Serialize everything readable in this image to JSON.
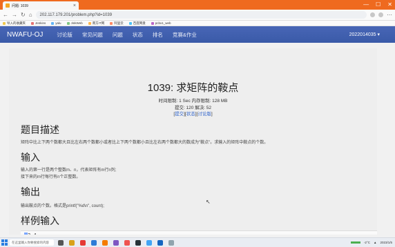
{
  "browser": {
    "tab_title": "问题: 1039",
    "url": "202.117.179.201/problem.php?id=1039",
    "win_minimize": "—",
    "win_maximize": "☐",
    "win_close": "✕",
    "bookmarks": [
      "导入的收藏夹",
      "Jenkins",
      "yalu",
      "JinkWeb",
      "南方IT网",
      "阿里云",
      "百度网盘",
      "pcbx1_web"
    ]
  },
  "site": {
    "brand": "NWAFU-OJ",
    "nav": [
      "讨论版",
      "常见问题",
      "问题",
      "状态",
      "排名",
      "竞赛&作业"
    ],
    "user": "2022014035 ▾"
  },
  "problem": {
    "title": "1039: 求矩阵的鞍点",
    "limits": "时间限制: 1 Sec  内存限制: 128 MB",
    "stats": "提交: 120  解决: 52",
    "links": [
      "提交",
      "状态",
      "讨论版"
    ]
  },
  "sections": {
    "desc_h": "题目描述",
    "desc_p": "矩阵中比上下两个数都大且比左右两个数都小或者比上下两个数都小且比左右两个数都大的数成为\"鞍点\"。求输入的矩阵中鞍点的个数。",
    "input_h": "输入",
    "input_p1": "输入的第一行是两个整数m、n，代表矩阵有m行n列;",
    "input_p2": "接下来的m行每行有n个正整数。",
    "output_h": "输出",
    "output_p": "输出鞍点的个数。格式是printf(\"%d\\n\", count);",
    "sample_h": "样例输入",
    "sample_text": "3  4"
  },
  "taskbar": {
    "search_placeholder": "在这里输入你要搜索的内容",
    "weather": "-2°C",
    "clock": "2023/1/5"
  }
}
